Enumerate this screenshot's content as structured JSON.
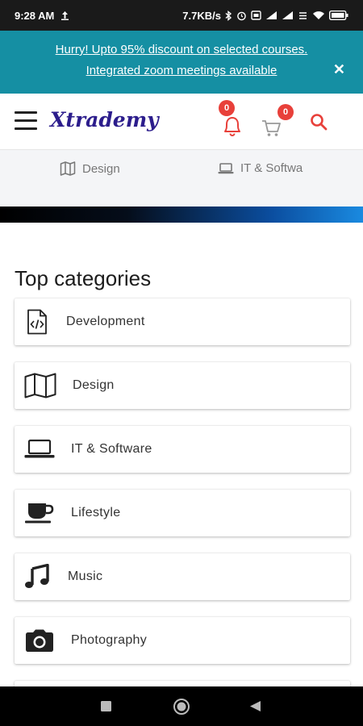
{
  "status_bar": {
    "time": "9:28 AM",
    "network_speed": "7.7KB/s",
    "icons": [
      "upload-icon",
      "bluetooth-icon",
      "alarm-icon",
      "sim-icon",
      "signal-icon",
      "wifi-icon",
      "battery-icon"
    ]
  },
  "promo": {
    "line1": "Hurry! Upto 95% discount on selected courses.",
    "line2": "Integrated zoom meetings available",
    "close_label": "✕",
    "background": "#158fa3"
  },
  "header": {
    "logo": "Xtrademy",
    "logo_color": "#2c1d8c",
    "notification_count": "0",
    "cart_count": "0",
    "accent_color": "#e8403a"
  },
  "tabs": [
    {
      "label": "Design",
      "icon": "map-icon"
    },
    {
      "label": "IT & Softwa",
      "icon": "laptop-icon"
    }
  ],
  "top_categories": {
    "title": "Top categories",
    "items": [
      {
        "label": "Development",
        "icon": "code-file-icon"
      },
      {
        "label": "Design",
        "icon": "map-icon"
      },
      {
        "label": "IT & Software",
        "icon": "laptop-icon"
      },
      {
        "label": "Lifestyle",
        "icon": "coffee-cup-icon"
      },
      {
        "label": "Music",
        "icon": "music-note-icon"
      },
      {
        "label": "Photography",
        "icon": "camera-icon"
      }
    ]
  }
}
